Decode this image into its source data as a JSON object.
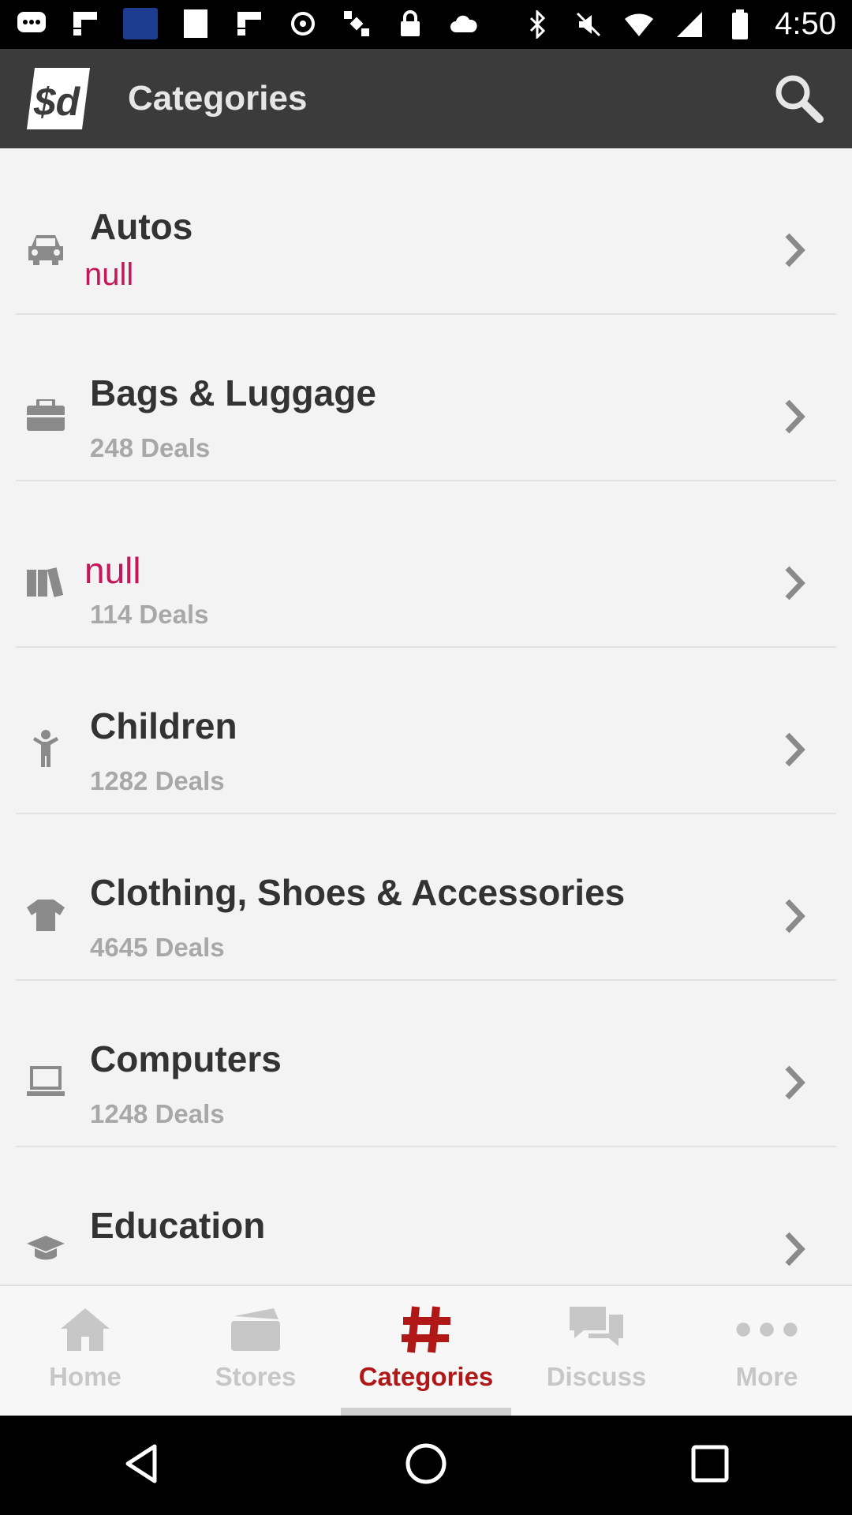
{
  "status_bar": {
    "time": "4:50",
    "icons": [
      "message-icon",
      "flipboard-icon",
      "kbs-news-icon",
      "blank-icon",
      "flipboard-icon",
      "sync-icon",
      "satellite-icon",
      "lock-icon",
      "cloud-icon",
      "bluetooth-icon",
      "silent-icon",
      "wifi-icon",
      "signal-icon",
      "battery-icon"
    ],
    "kbs_label": "KBS NEWS"
  },
  "app_bar": {
    "logo_text": "$d",
    "title": "Categories",
    "background": "#3b3b3b"
  },
  "categories": [
    {
      "name": "Autos",
      "deals": "null",
      "icon": "car-icon",
      "name_is_null": false,
      "deals_is_null": true
    },
    {
      "name": "Bags & Luggage",
      "deals": "248 Deals",
      "icon": "briefcase-icon",
      "name_is_null": false,
      "deals_is_null": false
    },
    {
      "name": "null",
      "deals": "114 Deals",
      "icon": "books-icon",
      "name_is_null": true,
      "deals_is_null": false
    },
    {
      "name": "Children",
      "deals": "1282 Deals",
      "icon": "child-icon",
      "name_is_null": false,
      "deals_is_null": false
    },
    {
      "name": "Clothing, Shoes & Accessories",
      "deals": "4645 Deals",
      "icon": "tshirt-icon",
      "name_is_null": false,
      "deals_is_null": false
    },
    {
      "name": "Computers",
      "deals": "1248 Deals",
      "icon": "laptop-icon",
      "name_is_null": false,
      "deals_is_null": false
    },
    {
      "name": "Education",
      "deals": "",
      "icon": "graduation-cap-icon",
      "name_is_null": false,
      "deals_is_null": false
    }
  ],
  "bottom_nav": {
    "items": [
      {
        "label": "Home",
        "icon": "home-icon",
        "active": false
      },
      {
        "label": "Stores",
        "icon": "stores-icon",
        "active": false
      },
      {
        "label": "Categories",
        "icon": "hash-icon",
        "active": true
      },
      {
        "label": "Discuss",
        "icon": "chat-icon",
        "active": false
      },
      {
        "label": "More",
        "icon": "more-dots-icon",
        "active": false
      }
    ],
    "active_color": "#b01818",
    "inactive_color": "#c7c7c7"
  },
  "system_nav": [
    "back-icon",
    "home-circle-icon",
    "recents-icon"
  ]
}
